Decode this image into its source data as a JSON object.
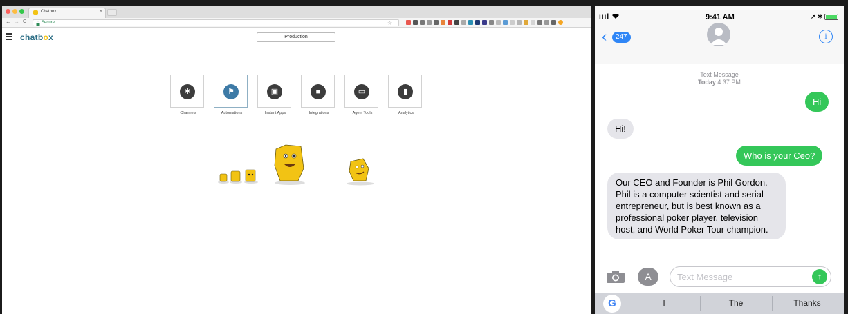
{
  "browser": {
    "tab_title": "Chatbox",
    "tab_close": "×",
    "nav": {
      "back": "←",
      "forward": "→",
      "reload": "C"
    },
    "omnibox": {
      "lock_icon": "lock-icon",
      "secure_label": "Secure"
    },
    "bookmark_star": "☆"
  },
  "app": {
    "logo_prefix": "chatb",
    "logo_o": "o",
    "logo_suffix": "x",
    "environment": "Production",
    "tiles": [
      {
        "label": "Channels",
        "icon": "✱"
      },
      {
        "label": "Automations",
        "icon": "⚑"
      },
      {
        "label": "Instant Apps",
        "icon": "▣"
      },
      {
        "label": "Integrations",
        "icon": "■"
      },
      {
        "label": "Agent Tools",
        "icon": "▭"
      },
      {
        "label": "Analytics",
        "icon": "▮"
      }
    ]
  },
  "phone": {
    "status": {
      "signal": "ıııl",
      "time": "9:41 AM",
      "indicators": "➚ ✱"
    },
    "back_count": "247",
    "info": "i",
    "stamp_title": "Text Message",
    "stamp_day": "Today",
    "stamp_time": "4:37 PM",
    "messages": [
      {
        "dir": "out",
        "text": "Hi"
      },
      {
        "dir": "in",
        "text": "Hi!"
      },
      {
        "dir": "out",
        "text": "Who is your Ceo?"
      },
      {
        "dir": "in",
        "text": "Our CEO and Founder is Phil Gordon.  Phil is a computer scientist and serial entrepreneur, but is best known as a professional poker player, television host, and World Poker Tour champion."
      }
    ],
    "compose_placeholder": "Text Message",
    "app_icon": "A",
    "send_icon": "↑",
    "google_label": "G",
    "suggestions": [
      "I",
      "The",
      "Thanks"
    ]
  },
  "colors": {
    "accent_blue": "#2f86f6",
    "sent_bubble": "#34c759",
    "received_bubble": "#e5e5ea",
    "brand_teal": "#2e6f86",
    "brand_yellow": "#f2c314"
  }
}
